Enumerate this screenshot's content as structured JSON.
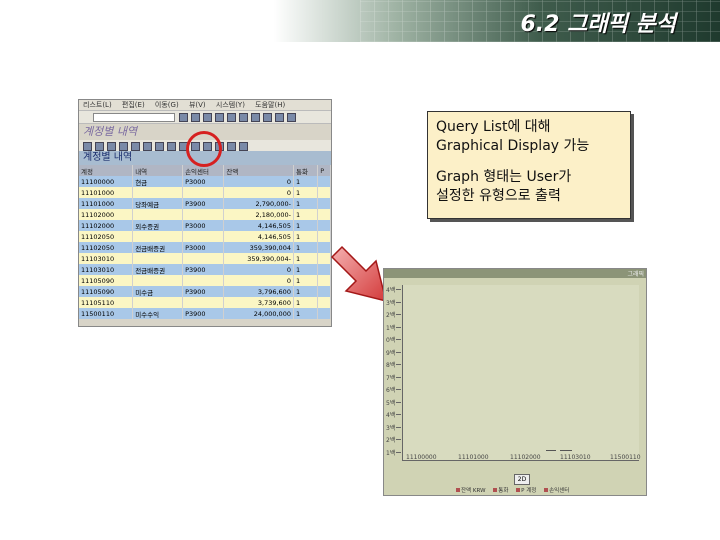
{
  "header": {
    "title": "6.2 그래픽 분석"
  },
  "sap": {
    "menu": [
      "리스트(L)",
      "편집(E)",
      "이동(G)",
      "뷰(V)",
      "시스템(Y)",
      "도움말(H)"
    ],
    "app_title": "계정별 내역",
    "list_title": "계정별 내역",
    "columns": [
      "계정",
      "내역",
      "손익센터",
      "잔액",
      "통화",
      "P"
    ],
    "rows": [
      {
        "style": "blue",
        "cells": [
          "11100000",
          "현금",
          "P3000",
          "0",
          "1",
          ""
        ]
      },
      {
        "style": "yel",
        "cells": [
          "11101000",
          "",
          "",
          "0",
          "1",
          ""
        ]
      },
      {
        "style": "blue",
        "cells": [
          "11101000",
          "당좌예금",
          "P3900",
          "2,790,000-",
          "1",
          ""
        ]
      },
      {
        "style": "yel",
        "cells": [
          "11102000",
          "",
          "",
          "2,180,000-",
          "1",
          ""
        ]
      },
      {
        "style": "blue",
        "cells": [
          "11102000",
          "외수증권",
          "P3000",
          "4,146,505",
          "1",
          ""
        ]
      },
      {
        "style": "yel",
        "cells": [
          "11102050",
          "",
          "",
          "4,146,505",
          "1",
          ""
        ]
      },
      {
        "style": "blue",
        "cells": [
          "11102050",
          "전금배증권",
          "P3000",
          "359,390,004",
          "1",
          ""
        ]
      },
      {
        "style": "yel",
        "cells": [
          "11103010",
          "",
          "",
          "359,390,004-",
          "1",
          ""
        ]
      },
      {
        "style": "blue",
        "cells": [
          "11103010",
          "전금배증권",
          "P3900",
          "0",
          "1",
          ""
        ]
      },
      {
        "style": "yel",
        "cells": [
          "11105090",
          "",
          "",
          "0",
          "1",
          ""
        ]
      },
      {
        "style": "blue",
        "cells": [
          "11105090",
          "미수금",
          "P3900",
          "3,796,600",
          "1",
          ""
        ]
      },
      {
        "style": "yel",
        "cells": [
          "11105110",
          "",
          "",
          "3,739,600",
          "1",
          ""
        ]
      },
      {
        "style": "blue",
        "cells": [
          "11500110",
          "미수수익",
          "P3900",
          "24,000,000",
          "1",
          ""
        ]
      }
    ]
  },
  "callout": {
    "line1": "Query List에 대해",
    "line2": "Graphical Display 가능",
    "line3": "Graph 형태는 User가",
    "line4": "설정한 유형으로 출력"
  },
  "graph": {
    "window_label": "그래픽",
    "y_labels": [
      "4백",
      "3백",
      "2백",
      "1백",
      "0백",
      "9백",
      "8백",
      "7백",
      "6백",
      "5백",
      "4백",
      "3백",
      "2백",
      "1백"
    ],
    "x_labels": [
      "11100000",
      "11101000",
      "11102000",
      "11103010",
      "11500110"
    ],
    "button_label": "2D",
    "legend": [
      "잔액 KRW",
      "통화",
      "P 계정",
      "손익센터"
    ]
  }
}
